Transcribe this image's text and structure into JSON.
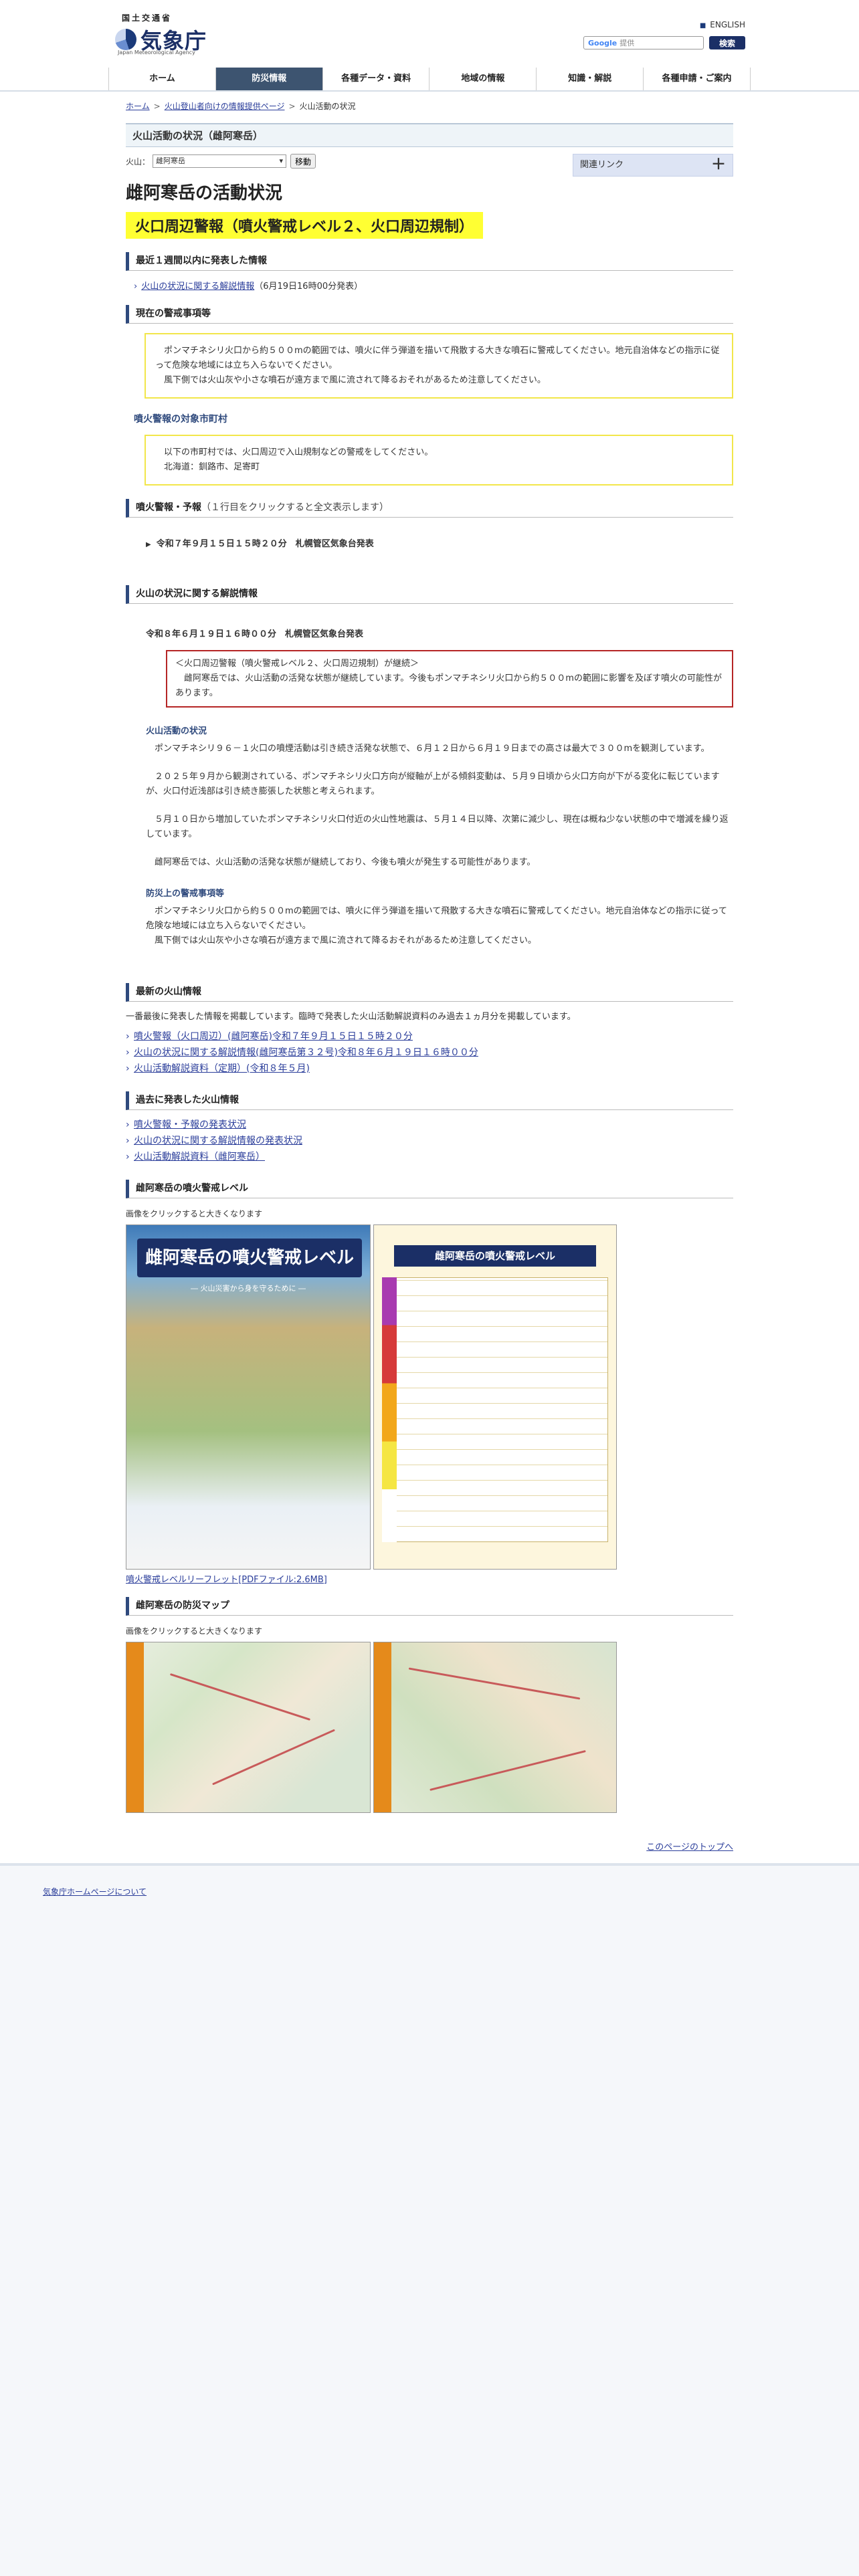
{
  "header": {
    "gov_name": "国土交通省",
    "agency_name": "気象庁",
    "agency_name_en": "Japan Meteorological Agency",
    "english_link": "ENGLISH",
    "search_engine": "Google",
    "search_placeholder": "提供",
    "search_button": "検索"
  },
  "nav": [
    "ホーム",
    "防災情報",
    "各種データ・資料",
    "地域の情報",
    "知識・解説",
    "各種申請・ご案内"
  ],
  "nav_active": 1,
  "breadcrumb": [
    "ホーム",
    "火山登山者向けの情報提供ページ",
    "火山活動の状況"
  ],
  "page_head": "火山活動の状況（雌阿寒岳）",
  "selector": {
    "label": "火山：",
    "value": "雌阿寒岳",
    "button": "移動"
  },
  "related_links": {
    "label": "関連リンク",
    "plus": "＋"
  },
  "title": "雌阿寒岳の活動状況",
  "alert_banner": "火口周辺警報（噴火警戒レベル２、火口周辺規制）",
  "sec_recent": {
    "heading": "最近１週間以内に発表した情報",
    "link": "火山の状況に関する解説情報",
    "suffix": "（6月19日16時00分発表）"
  },
  "sec_warning": {
    "heading": "現在の警戒事項等",
    "text1": "ポンマチネシリ火口から約５００mの範囲では、噴火に伴う弾道を描いて飛散する大きな噴石に警戒してください。地元自治体などの指示に従って危険な地域には立ち入らないでください。",
    "text2": "風下側では火山灰や小さな噴石が遠方まで風に流されて降るおそれがあるため注意してください。"
  },
  "sec_target": {
    "heading": "噴火警報の対象市町村",
    "text1": "以下の市町村では、火口周辺で入山規制などの警戒をしてください。",
    "text2": "北海道：釧路市、足寄町"
  },
  "sec_bulletin": {
    "heading": "噴火警報・予報",
    "note": "（１行目をクリックすると全文表示します）",
    "item": "令和７年９月１５日１５時２０分　札幌管区気象台発表"
  },
  "sec_commentary": {
    "heading": "火山の状況に関する解説情報",
    "issued": "令和８年６月１９日１６時００分　札幌管区気象台発表",
    "box1": "＜火口周辺警報（噴火警戒レベル２、火口周辺規制）が継続＞",
    "box2": "雌阿寒岳では、火山活動の活発な状態が継続しています。今後もポンマチネシリ火口から約５００mの範囲に影響を及ぼす噴火の可能性があります。",
    "sub1": "火山活動の状況",
    "p1": "ポンマチネシリ９６－１火口の噴煙活動は引き続き活発な状態で、６月１２日から６月１９日までの高さは最大で３００mを観測しています。",
    "p2": "２０２５年９月から観測されている、ポンマチネシリ火口方向が縦軸が上がる傾斜変動は、５月９日頃から火口方向が下がる変化に転じていますが、火口付近浅部は引き続き膨張した状態と考えられます。",
    "p3": "５月１０日から増加していたポンマチネシリ火口付近の火山性地震は、５月１４日以降、次第に減少し、現在は概ね少ない状態の中で増減を繰り返しています。",
    "p4": "雌阿寒岳では、火山活動の活発な状態が継続しており、今後も噴火が発生する可能性があります。",
    "sub2": "防災上の警戒事項等",
    "p5": "ポンマチネシリ火口から約５００mの範囲では、噴火に伴う弾道を描いて飛散する大きな噴石に警戒してください。地元自治体などの指示に従って危険な地域には立ち入らないでください。",
    "p6": "風下側では火山灰や小さな噴石が遠方まで風に流されて降るおそれがあるため注意してください。"
  },
  "sec_latest": {
    "heading": "最新の火山情報",
    "intro": "一番最後に発表した情報を掲載しています。臨時で発表した火山活動解説資料のみ過去１ヵ月分を掲載しています。",
    "links": [
      "噴火警報（火口周辺）(雌阿寒岳)令和７年９月１５日１５時２０分",
      "火山の状況に関する解説情報(雌阿寒岳第３２号)令和８年６月１９日１６時００分",
      "火山活動解説資料（定期）(令和８年５月)"
    ]
  },
  "sec_past": {
    "heading": "過去に発表した火山情報",
    "links": [
      "噴火警報・予報の発表状況",
      "火山の状況に関する解説情報の発表状況",
      "火山活動解説資料（雌阿寒岳）"
    ]
  },
  "sec_level": {
    "heading": "雌阿寒岳の噴火警戒レベル",
    "caption": "画像をクリックすると大きくなります",
    "leaflet_title": "雌阿寒岳の噴火警戒レベル",
    "leaflet_sub": "― 火山災害から身を守るために ―",
    "table_title": "雌阿寒岳の噴火警戒レベル",
    "pdf_link": "噴火警戒レベルリーフレット[PDFファイル:2.6MB]"
  },
  "sec_map": {
    "heading": "雌阿寒岳の防災マップ",
    "caption": "画像をクリックすると大きくなります"
  },
  "pagetop": "このページのトップへ",
  "footer": {
    "link": "気象庁ホームページについて"
  }
}
